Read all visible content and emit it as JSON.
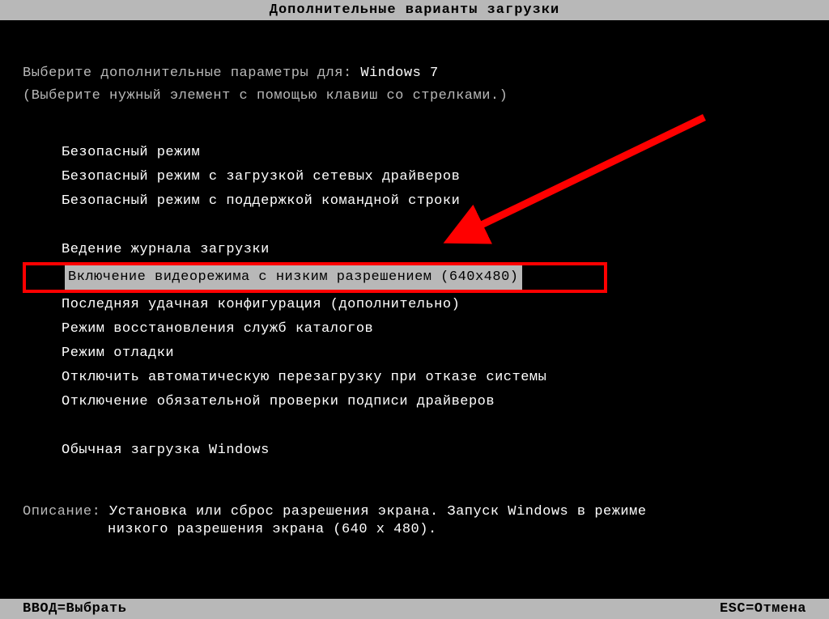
{
  "title": "Дополнительные варианты загрузки",
  "instruction_prefix": "Выберите дополнительные параметры для: ",
  "os_name": "Windows 7",
  "instruction_hint": "(Выберите нужный элемент с помощью клавиш со стрелками.)",
  "menu": {
    "items": [
      "Безопасный режим",
      "Безопасный режим с загрузкой сетевых драйверов",
      "Безопасный режим с поддержкой командной строки",
      "Ведение журнала загрузки",
      "Включение видеорежима с низким разрешением (640x480)",
      "Последняя удачная конфигурация (дополнительно)",
      "Режим восстановления служб каталогов",
      "Режим отладки",
      "Отключить автоматическую перезагрузку при отказе системы",
      "Отключение обязательной проверки подписи драйверов",
      "Обычная загрузка Windows"
    ],
    "selected_index": 4
  },
  "description": {
    "label": "Описание: ",
    "text_line1": "Установка или сброс разрешения экрана. Запуск Windows в режиме",
    "text_line2": "низкого разрешения экрана (640 x 480)."
  },
  "footer": {
    "enter": "ВВОД=Выбрать",
    "esc": "ESC=Отмена"
  },
  "annotation": {
    "arrow_color": "#ff0000",
    "highlight_color": "#ff0000"
  }
}
